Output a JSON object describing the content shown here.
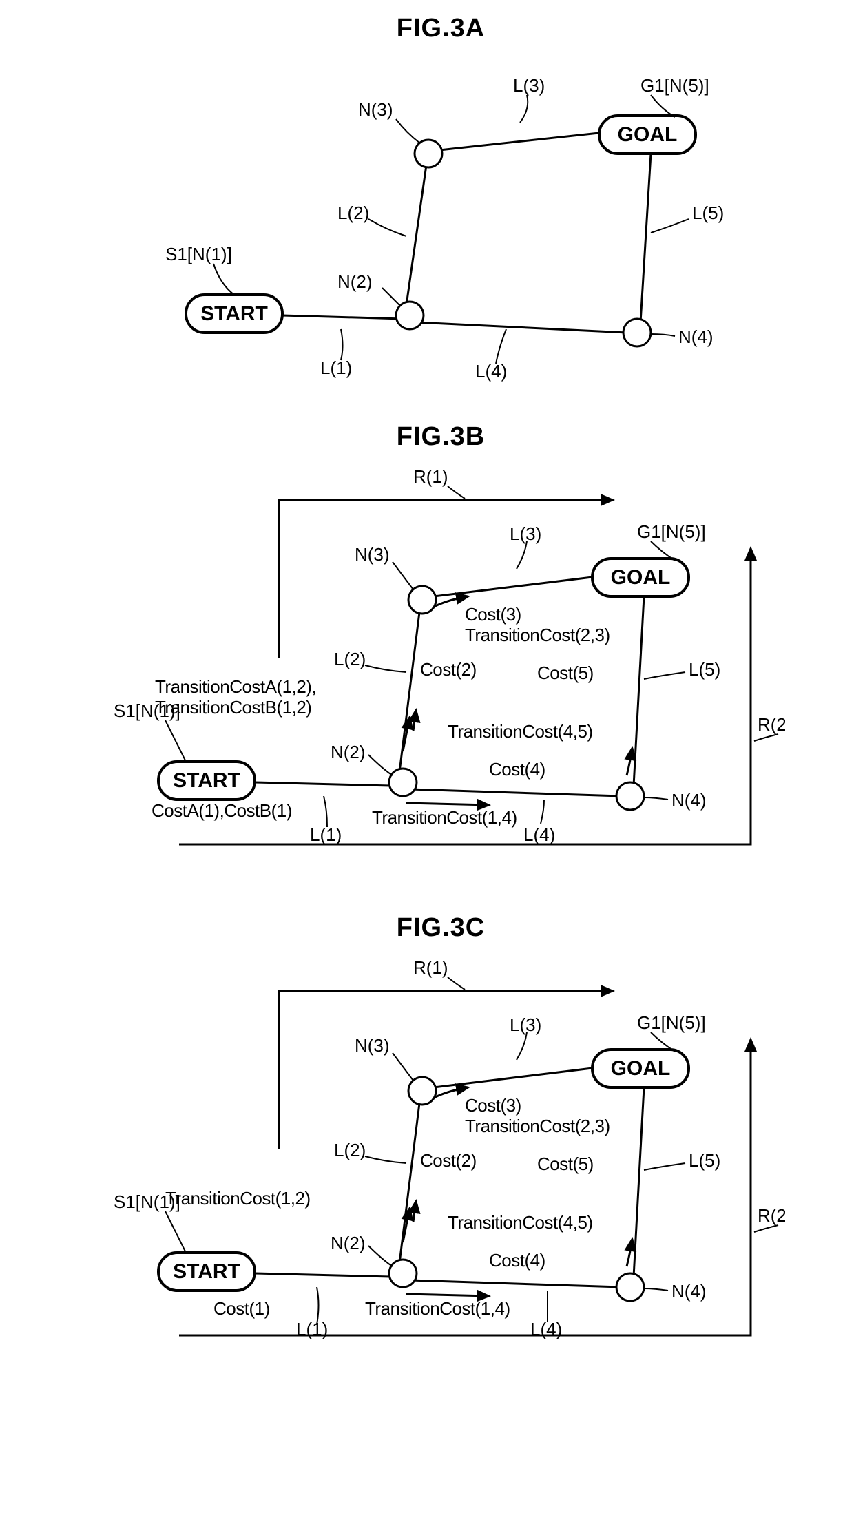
{
  "figA": {
    "title": "FIG.3A",
    "start": "START",
    "goal": "GOAL",
    "s1": "S1[N(1)]",
    "g1": "G1[N(5)]",
    "n2": "N(2)",
    "n3": "N(3)",
    "n4": "N(4)",
    "l1": "L(1)",
    "l2": "L(2)",
    "l3": "L(3)",
    "l4": "L(4)",
    "l5": "L(5)"
  },
  "figB": {
    "title": "FIG.3B",
    "start": "START",
    "goal": "GOAL",
    "s1": "S1[N(1)]",
    "g1": "G1[N(5)]",
    "n2": "N(2)",
    "n3": "N(3)",
    "n4": "N(4)",
    "l1": "L(1)",
    "l2": "L(2)",
    "l3": "L(3)",
    "l4": "L(4)",
    "l5": "L(5)",
    "r1": "R(1)",
    "r2": "R(2)",
    "costA1B1": "CostA(1),CostB(1)",
    "tcA12": "TransitionCostA(1,2),",
    "tcB12": "TransitionCostB(1,2)",
    "cost2": "Cost(2)",
    "cost3": "Cost(3)",
    "tc23": "TransitionCost(2,3)",
    "cost4": "Cost(4)",
    "cost5": "Cost(5)",
    "tc45": "TransitionCost(4,5)",
    "tc14": "TransitionCost(1,4)"
  },
  "figC": {
    "title": "FIG.3C",
    "start": "START",
    "goal": "GOAL",
    "s1": "S1[N(1)]",
    "g1": "G1[N(5)]",
    "n2": "N(2)",
    "n3": "N(3)",
    "n4": "N(4)",
    "l1": "L(1)",
    "l2": "L(2)",
    "l3": "L(3)",
    "l4": "L(4)",
    "l5": "L(5)",
    "r1": "R(1)",
    "r2": "R(2)",
    "cost1": "Cost(1)",
    "tc12": "TransitionCost(1,2)",
    "cost2": "Cost(2)",
    "cost3": "Cost(3)",
    "tc23": "TransitionCost(2,3)",
    "cost4": "Cost(4)",
    "cost5": "Cost(5)",
    "tc45": "TransitionCost(4,5)",
    "tc14": "TransitionCost(1,4)"
  }
}
